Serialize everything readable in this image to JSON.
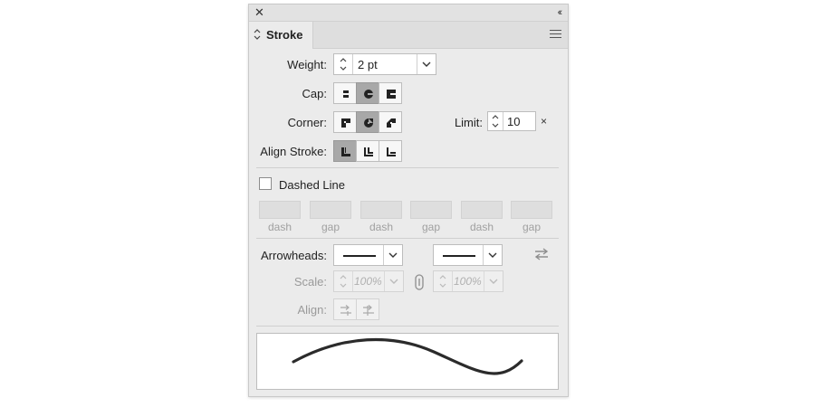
{
  "panel": {
    "tab_label": "Stroke",
    "weight": {
      "label": "Weight:",
      "value": "2 pt"
    },
    "cap": {
      "label": "Cap:",
      "buttons": [
        "butt-cap",
        "round-cap",
        "projecting-cap"
      ],
      "selected": "round-cap"
    },
    "corner": {
      "label": "Corner:",
      "buttons": [
        "miter-join",
        "round-join",
        "bevel-join"
      ],
      "selected": "round-join"
    },
    "limit": {
      "label": "Limit:",
      "value": "10",
      "unit": "×"
    },
    "align_stroke": {
      "label": "Align Stroke:",
      "buttons": [
        "align-center",
        "align-inside",
        "align-outside"
      ],
      "selected": "align-center"
    },
    "dashed": {
      "label": "Dashed Line",
      "checked": false,
      "field_labels": [
        "dash",
        "gap",
        "dash",
        "gap",
        "dash",
        "gap"
      ]
    },
    "arrowheads": {
      "label": "Arrowheads:"
    },
    "scale": {
      "label": "Scale:",
      "start": "100%",
      "end": "100%"
    },
    "align": {
      "label": "Align:"
    }
  },
  "colors": {
    "panel_bg": "#ebebeb",
    "selected_btn": "#a8a8a8",
    "stroke": "#2b2b2b"
  }
}
